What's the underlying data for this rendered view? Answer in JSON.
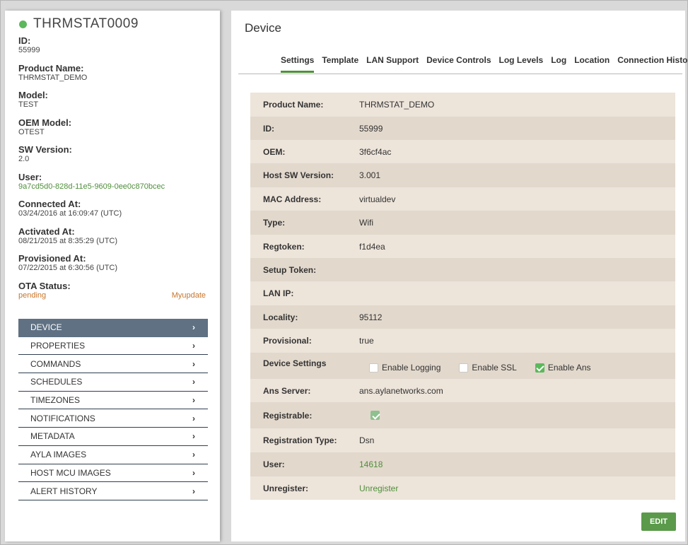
{
  "device": {
    "title": "THRMSTAT0009",
    "fields": [
      {
        "label": "ID:",
        "value": "55999"
      },
      {
        "label": "Product Name:",
        "value": "THRMSTAT_DEMO"
      },
      {
        "label": "Model:",
        "value": "TEST"
      },
      {
        "label": "OEM Model:",
        "value": "OTEST"
      },
      {
        "label": "SW Version:",
        "value": "2.0"
      },
      {
        "label": "User:",
        "value": "9a7cd5d0-828d-11e5-9609-0ee0c870bcec"
      },
      {
        "label": "Connected At:",
        "value": "03/24/2016 at 16:09:47 (UTC)"
      },
      {
        "label": "Activated At:",
        "value": "08/21/2015 at 8:35:29 (UTC)"
      },
      {
        "label": "Provisioned At:",
        "value": "07/22/2015 at 6:30:56 (UTC)"
      }
    ],
    "ota": {
      "label": "OTA Status:",
      "status": "pending",
      "action": "Myupdate"
    }
  },
  "menu": [
    "DEVICE",
    "PROPERTIES",
    "COMMANDS",
    "SCHEDULES",
    "TIMEZONES",
    "NOTIFICATIONS",
    "METADATA",
    "AYLA IMAGES",
    "HOST MCU IMAGES",
    "ALERT HISTORY"
  ],
  "main": {
    "title": "Device",
    "tabs": [
      "Settings",
      "Template",
      "LAN Support",
      "Device Controls",
      "Log Levels",
      "Log",
      "Location",
      "Connection History"
    ],
    "rows": {
      "product_name": {
        "label": "Product Name:",
        "value": "THRMSTAT_DEMO"
      },
      "id": {
        "label": "ID:",
        "value": "55999"
      },
      "oem": {
        "label": "OEM:",
        "value": "3f6cf4ac"
      },
      "host_sw": {
        "label": "Host SW Version:",
        "value": "3.001"
      },
      "mac": {
        "label": "MAC Address:",
        "value": "virtualdev"
      },
      "type": {
        "label": "Type:",
        "value": "Wifi"
      },
      "regtoken": {
        "label": "Regtoken:",
        "value": "f1d4ea"
      },
      "setup_token": {
        "label": "Setup Token:",
        "value": ""
      },
      "lan_ip": {
        "label": "LAN IP:",
        "value": ""
      },
      "locality": {
        "label": "Locality:",
        "value": "95112"
      },
      "provisional": {
        "label": "Provisional:",
        "value": "true"
      },
      "device_settings": {
        "label": "Device Settings",
        "options": [
          {
            "label": "Enable Logging",
            "checked": false
          },
          {
            "label": "Enable SSL",
            "checked": false
          },
          {
            "label": "Enable Ans",
            "checked": true
          }
        ]
      },
      "ans_server": {
        "label": "Ans Server:",
        "value": "ans.aylanetworks.com"
      },
      "registrable": {
        "label": "Registrable:",
        "checked": true
      },
      "registration_type": {
        "label": "Registration Type:",
        "value": "Dsn"
      },
      "user": {
        "label": "User:",
        "value": "14618"
      },
      "unregister": {
        "label": "Unregister:",
        "value": "Unregister"
      }
    },
    "edit_label": "EDIT"
  },
  "colors": {
    "accent_green": "#5a9a4a",
    "status_online": "#5cb85c",
    "menu_active": "#5f7183",
    "ota_pending": "#c7762a"
  }
}
